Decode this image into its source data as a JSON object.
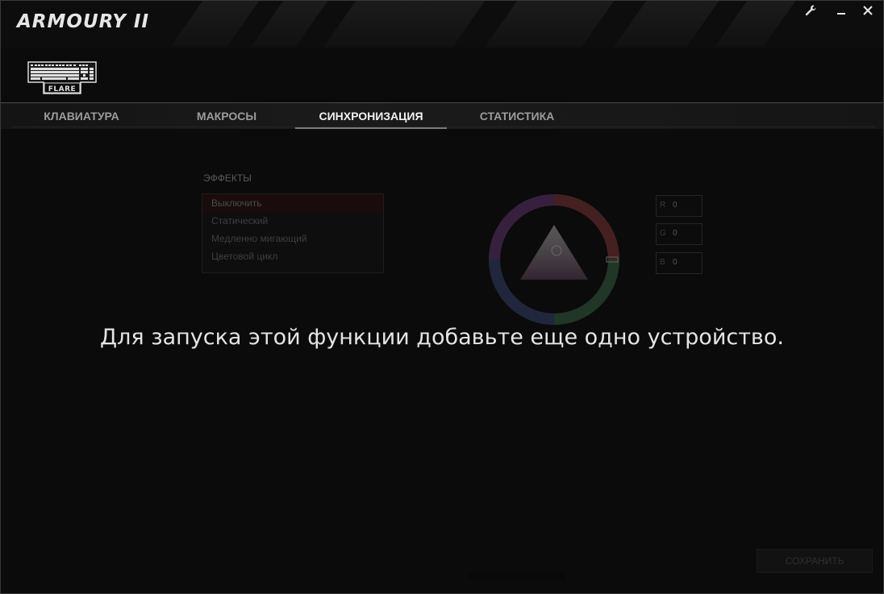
{
  "app": {
    "title": "ARMOURY II",
    "device_label": "FLARE"
  },
  "window_controls": {
    "settings_icon": "wrench-icon",
    "minimize_icon": "minimize-icon",
    "close_icon": "close-icon"
  },
  "tabs": [
    {
      "label": "КЛАВИАТУРА",
      "active": false
    },
    {
      "label": "МАКРОСЫ",
      "active": false
    },
    {
      "label": "СИНХРОНИЗАЦИЯ",
      "active": true
    },
    {
      "label": "СТАТИСТИКА",
      "active": false
    }
  ],
  "effects": {
    "title": "ЭФФЕКТЫ",
    "items": [
      "Выключить",
      "Статический",
      "Медленно мигающий",
      "Цветовой цикл"
    ],
    "selected": "Выключить"
  },
  "rgb": {
    "r_label": "R",
    "r_value": "0",
    "g_label": "G",
    "g_value": "0",
    "b_label": "B",
    "b_value": "0"
  },
  "save_label": "СОХРАНИТЬ",
  "overlay_message": "Для запуска этой функции добавьте еще одно устройство."
}
